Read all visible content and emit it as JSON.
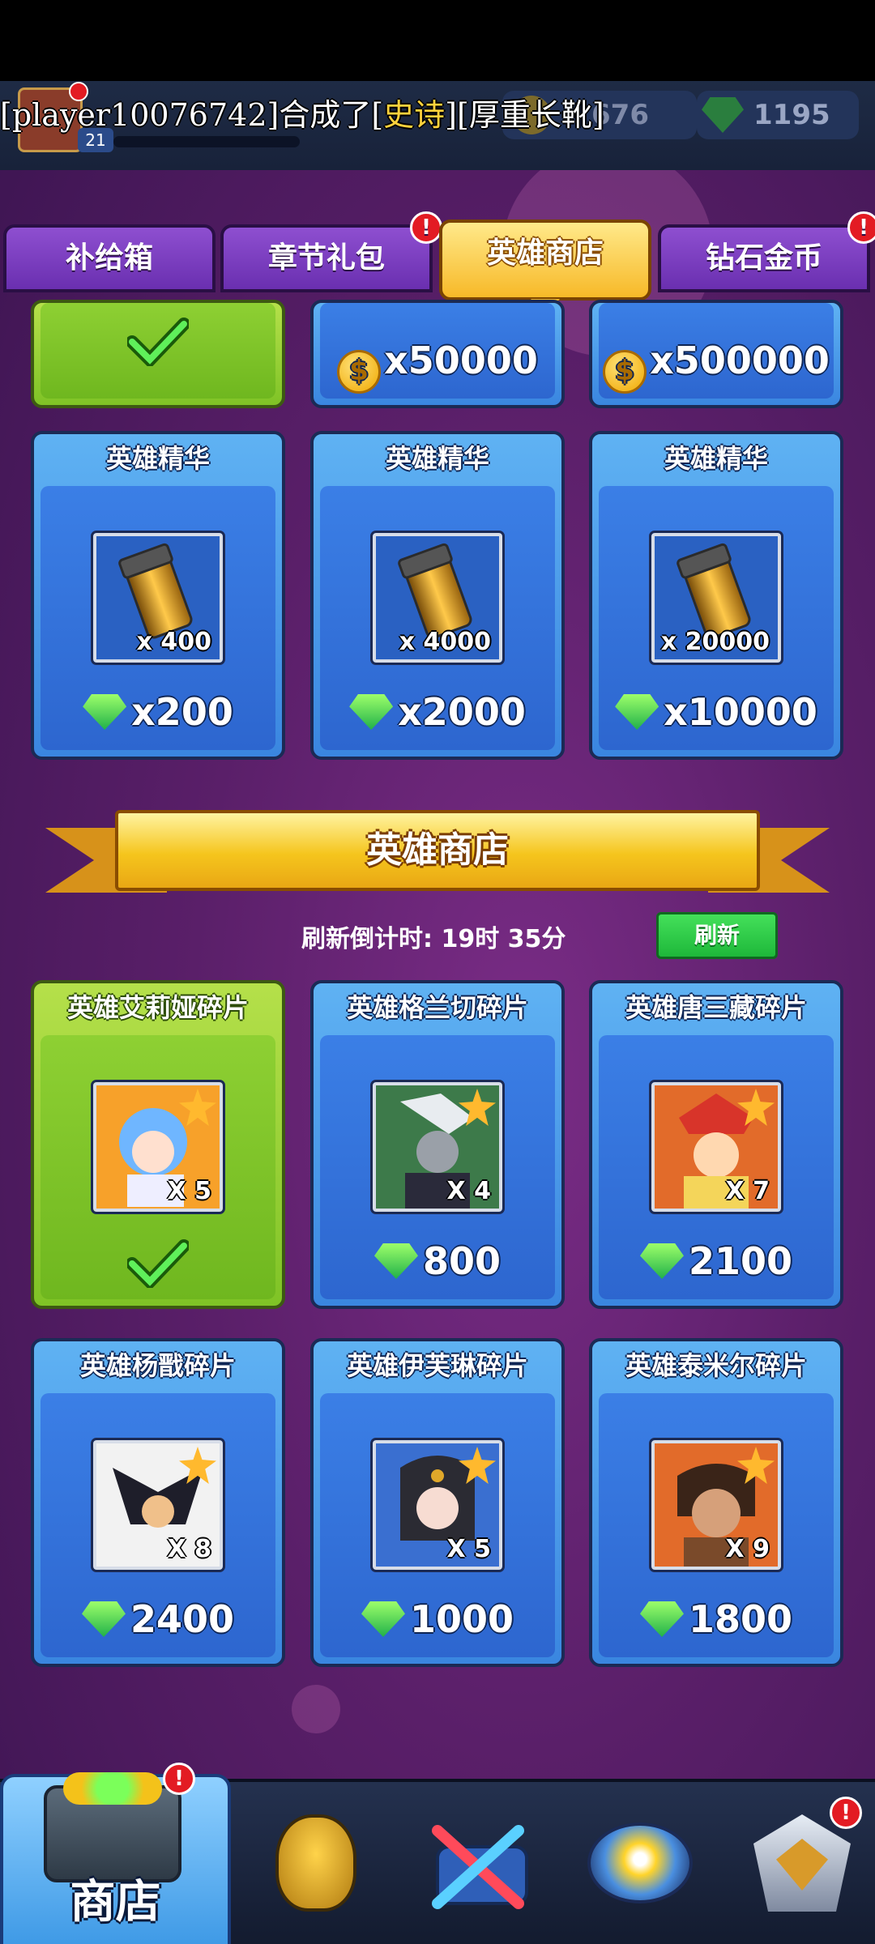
{
  "hud": {
    "gold_amount": "676",
    "gem_amount": "1195",
    "player_level": "21"
  },
  "broadcast": {
    "prefix": "[player10076742]合成了[",
    "rarity": "史诗",
    "item": "][厚重长靴]"
  },
  "tabs": [
    {
      "label": "补给箱",
      "badge": false
    },
    {
      "label": "章节礼包",
      "badge": true
    },
    {
      "label": "英雄商店",
      "badge": false,
      "active": true
    },
    {
      "label": "钻石金币",
      "badge": true
    }
  ],
  "coin_row": {
    "items": [
      {
        "amount": "x50000"
      },
      {
        "amount": "x500000"
      }
    ]
  },
  "essence_row": [
    {
      "title": "英雄精华",
      "qty": "x 400",
      "price": "x200"
    },
    {
      "title": "英雄精华",
      "qty": "x 4000",
      "price": "x2000"
    },
    {
      "title": "英雄精华",
      "qty": "x 20000",
      "price": "x10000"
    }
  ],
  "hero_shop": {
    "banner": "英雄商店",
    "countdown": "刷新倒计时: 19时 35分",
    "refresh_label": "刷新",
    "items": [
      {
        "title": "英雄艾莉娅碎片",
        "qty": "X 5",
        "purchased": true,
        "color": "#f7a12a"
      },
      {
        "title": "英雄格兰切碎片",
        "qty": "X 4",
        "price": "800",
        "color": "#3d7a4a"
      },
      {
        "title": "英雄唐三藏碎片",
        "qty": "X 7",
        "price": "2100",
        "color": "#e26b2a"
      },
      {
        "title": "英雄杨戬碎片",
        "qty": "X 8",
        "price": "2400",
        "color": "#e26b2a"
      },
      {
        "title": "英雄伊芙琳碎片",
        "qty": "X 5",
        "price": "1000",
        "color": "#3a6fd0"
      },
      {
        "title": "英雄泰米尔碎片",
        "qty": "X 9",
        "price": "1800",
        "color": "#e26b2a"
      }
    ]
  },
  "bottom_nav": {
    "shop_label": "商店"
  },
  "icons": {
    "coin": "$",
    "exclamation": "!"
  }
}
